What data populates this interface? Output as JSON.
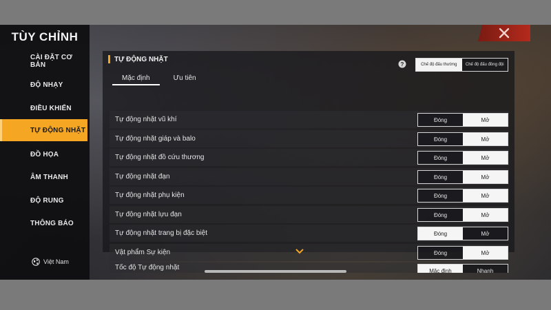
{
  "sidebar": {
    "title": "TÙY CHỈNH",
    "items": [
      {
        "label": "CÀI ĐẶT CƠ BẢN",
        "active": false
      },
      {
        "label": "ĐỘ NHẠY",
        "active": false
      },
      {
        "label": "ĐIỀU KHIỂN",
        "active": false
      },
      {
        "label": "TỰ ĐỘNG NHẶT",
        "active": true
      },
      {
        "label": "ĐỒ HỌA",
        "active": false
      },
      {
        "label": "ÂM THANH",
        "active": false
      },
      {
        "label": "ĐỘ RUNG",
        "active": false
      },
      {
        "label": "THÔNG BÁO",
        "active": false
      }
    ],
    "region": "Việt Nam",
    "region_icon": "globe-icon"
  },
  "close_icon": "close-icon",
  "panel": {
    "title": "TỰ ĐỘNG NHẶT",
    "help_icon": "help-icon",
    "mode_options": [
      "Chế độ đấu thường",
      "Chế độ đấu đồng đội"
    ],
    "mode_selected": 0,
    "tabs": [
      {
        "label": "Mặc định",
        "active": true
      },
      {
        "label": "Ưu tiên",
        "active": false
      }
    ],
    "rows": [
      {
        "label": "Tự động nhặt vũ khí",
        "options": [
          "Đóng",
          "Mở"
        ],
        "selected": 1
      },
      {
        "label": "Tự động nhặt giáp và balo",
        "options": [
          "Đóng",
          "Mở"
        ],
        "selected": 1
      },
      {
        "label": "Tự động nhặt đồ cứu thương",
        "options": [
          "Đóng",
          "Mở"
        ],
        "selected": 1
      },
      {
        "label": "Tự động nhặt đạn",
        "options": [
          "Đóng",
          "Mở"
        ],
        "selected": 1
      },
      {
        "label": "Tự động nhặt phụ kiện",
        "options": [
          "Đóng",
          "Mở"
        ],
        "selected": 1
      },
      {
        "label": "Tự động nhặt lựu đạn",
        "options": [
          "Đóng",
          "Mở"
        ],
        "selected": 1
      },
      {
        "label": "Tự động nhặt trang bị đặc biệt",
        "options": [
          "Đóng",
          "Mở"
        ],
        "selected": 0
      },
      {
        "label": "Vật phẩm Sự kiện",
        "options": [
          "Đóng",
          "Mở"
        ],
        "selected": 1
      },
      {
        "label": "Tốc độ Tự động nhặt",
        "options": [
          "Mặc định",
          "Nhanh"
        ],
        "selected": 0
      }
    ],
    "scroll_icon": "chevron-down-icon"
  },
  "colors": {
    "accent": "#f5a623",
    "close": "#b42a1c",
    "switch_on": "#f5f5f5"
  }
}
